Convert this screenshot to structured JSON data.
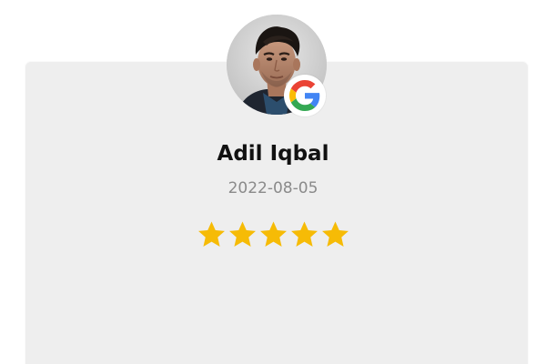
{
  "review": {
    "reviewer_name": "Adil Iqbal",
    "date": "2022-08-05",
    "rating": 5,
    "rating_max": 5,
    "source_icon": "google-icon"
  },
  "colors": {
    "card_background": "#eeeeee",
    "star": "#f6bb06",
    "name_text": "#111111",
    "date_text": "#8a8a8a",
    "google_blue": "#4285f4",
    "google_red": "#ea4335",
    "google_yellow": "#fbbc05",
    "google_green": "#34a853"
  }
}
